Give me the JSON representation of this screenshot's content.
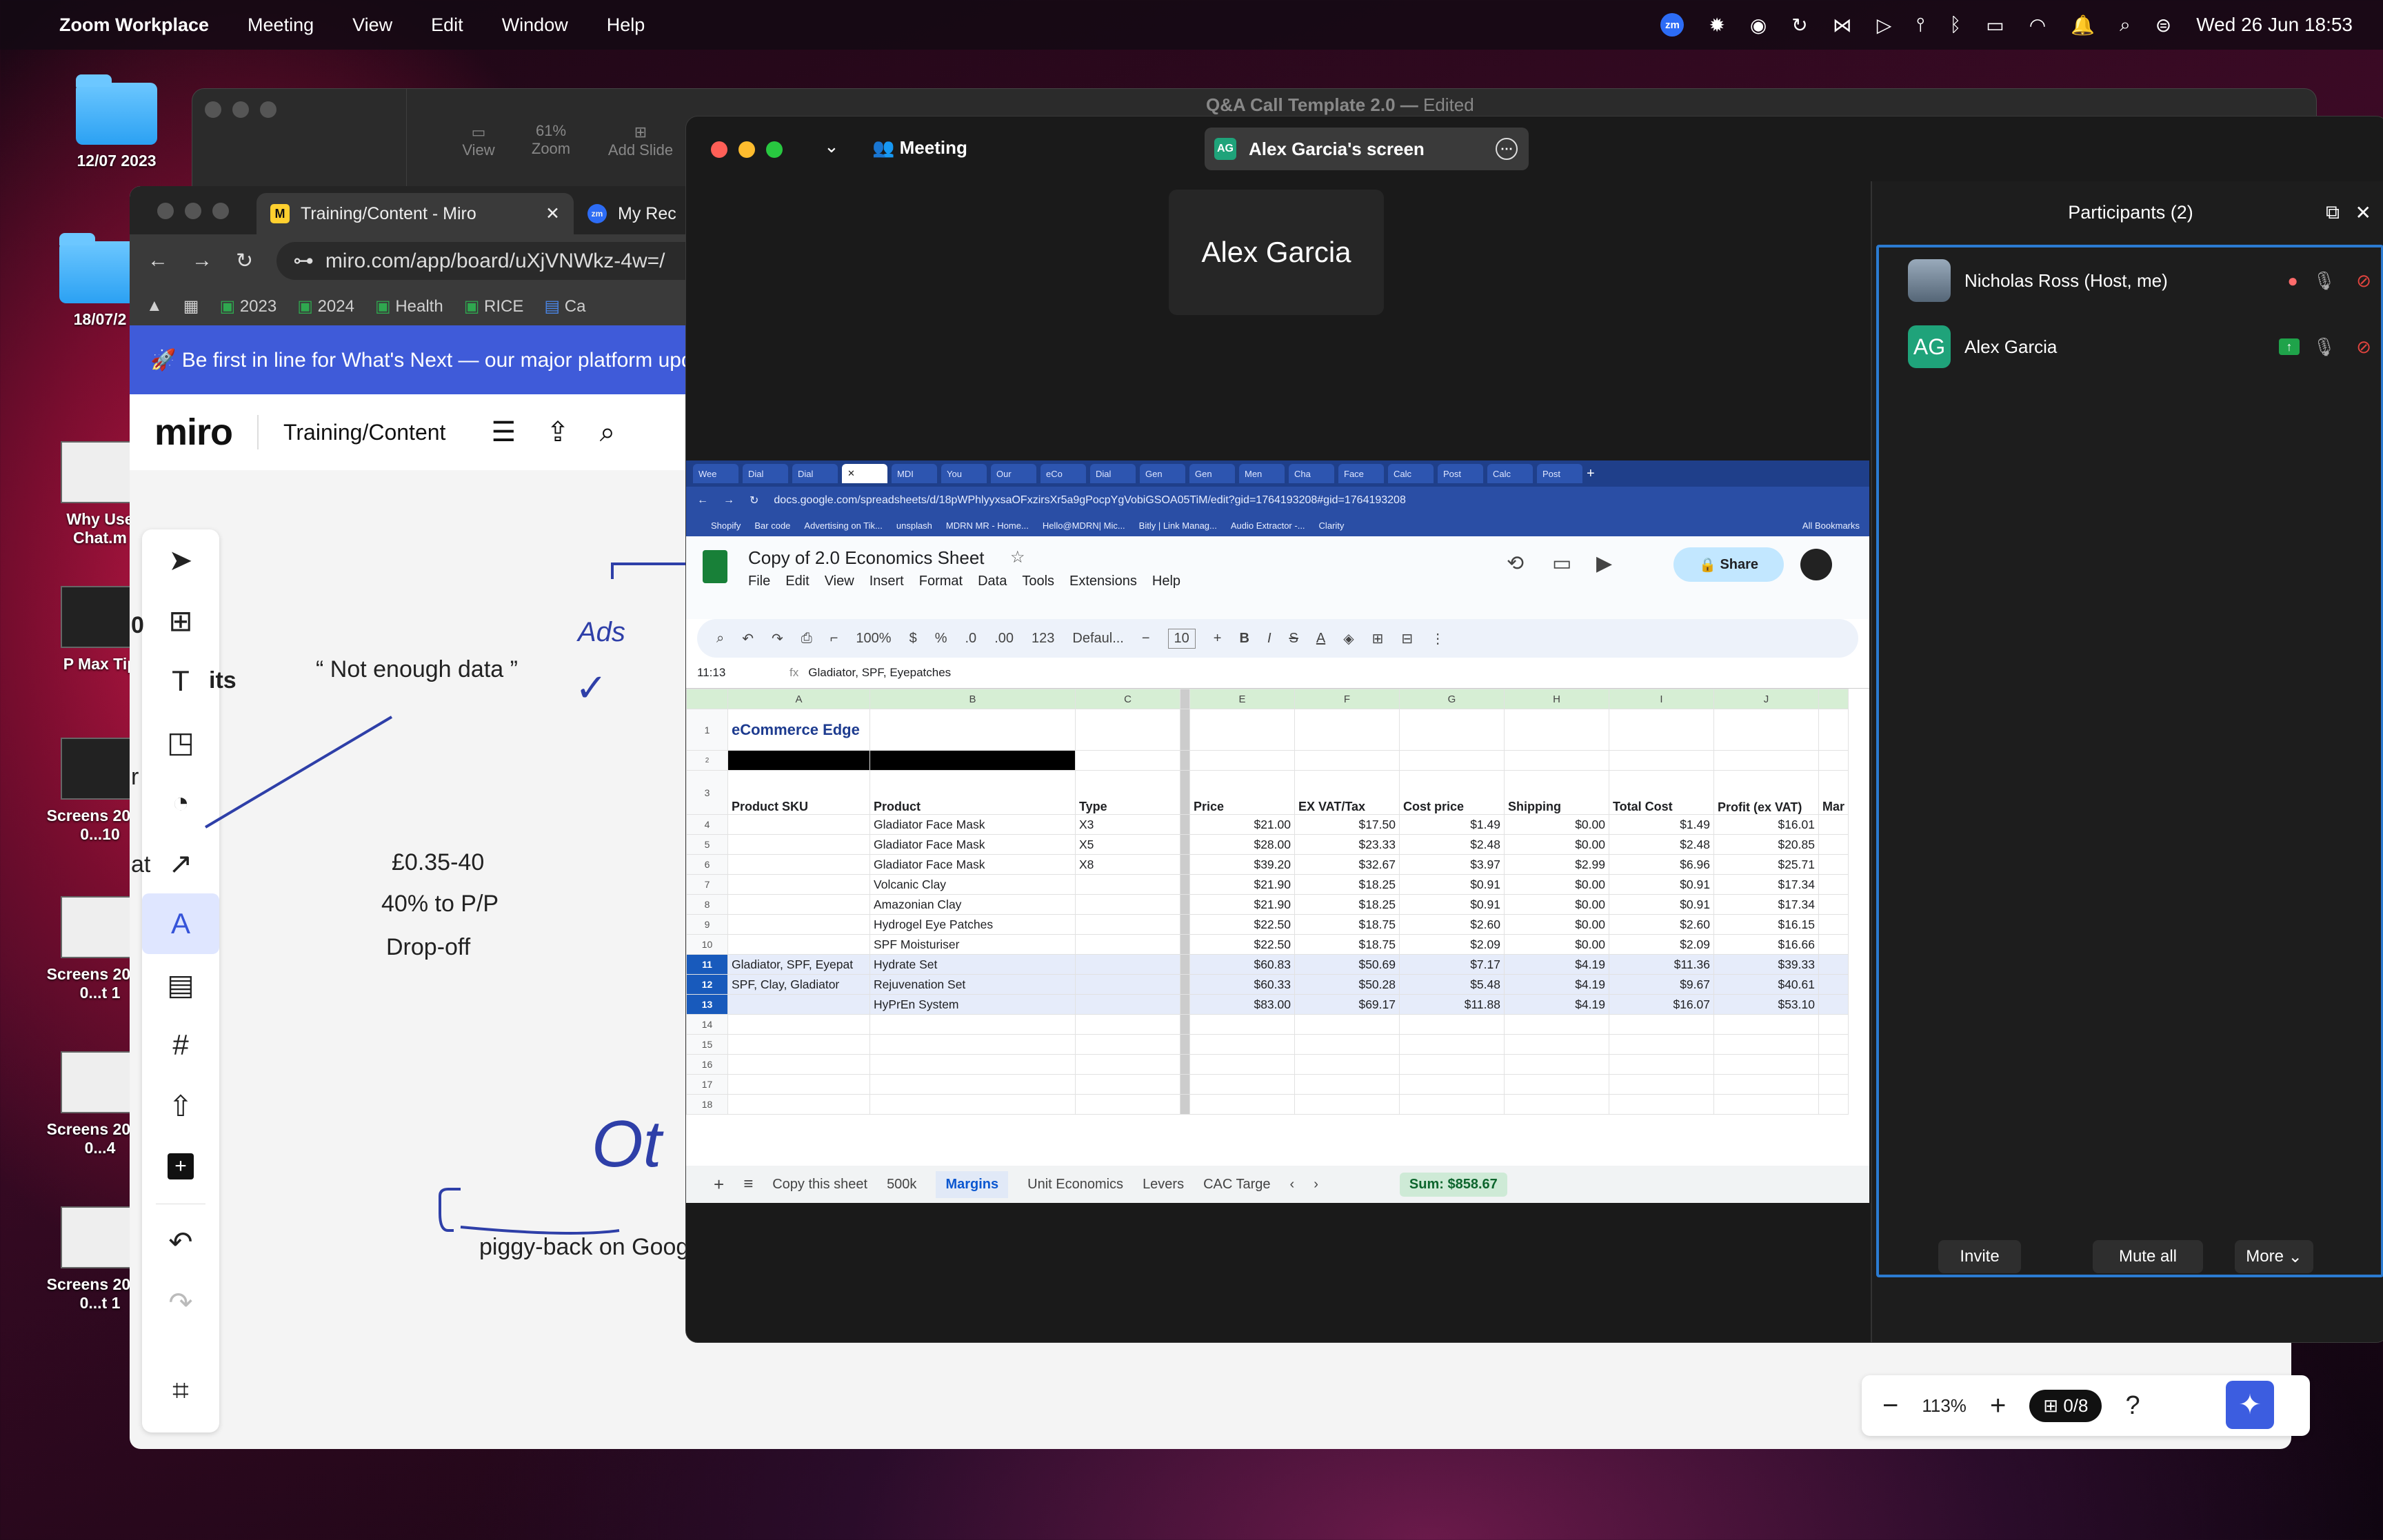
{
  "menubar": {
    "app": "Zoom Workplace",
    "items": [
      "Meeting",
      "View",
      "Edit",
      "Window",
      "Help"
    ],
    "datetime": "Wed 26 Jun  18:53",
    "zm": "zm"
  },
  "desktop": {
    "icons": [
      {
        "label": "12/07 2023"
      },
      {
        "label": "18/07/2"
      },
      {
        "label": "Why Use Chat.m"
      },
      {
        "label": "P Max Tip"
      },
      {
        "label": "Screens 2024-0...10"
      },
      {
        "label": "Screens 2024-0...t 1"
      },
      {
        "label": "Screens 2024-0...4"
      },
      {
        "label": "Screens 2024-0...t 1"
      }
    ]
  },
  "keynote": {
    "title": "Q&A Call Template 2.0",
    "edited": "Edited",
    "toolbar": {
      "view": "View",
      "zoom": "Zoom",
      "zoom_value": "61%",
      "add_slide": "Add Slide"
    }
  },
  "miro_browser": {
    "tabs": [
      "Training/Content - Miro",
      "My Rec"
    ],
    "url": "miro.com/app/board/uXjVNWkz-4w=/",
    "bookmarks": [
      "2023",
      "2024",
      "Health",
      "RICE",
      "Ca"
    ],
    "banner": "🚀 Be first in line for What's Next — our major platform upd",
    "board_name": "Training/Content",
    "logo": "miro",
    "canvas": {
      "quote": "“ Not enough data ”",
      "ads": "Ads",
      "check": "✓",
      "price": "£0.35-40",
      "pct": "40% to P/P",
      "dropoff": "Drop-off",
      "piggy": "piggy-back on Googl",
      "its": "its",
      "zero": "0",
      "r": "r",
      "at": "at",
      "oth": "Ot"
    },
    "zoom_level": "113%",
    "gift_count": "0/8"
  },
  "zoom": {
    "meeting_label": "Meeting",
    "share_label": "Alex Garcia's screen",
    "share_initials": "AG",
    "presenter_name": "Alex Garcia",
    "participants_title": "Participants (2)",
    "participants": [
      {
        "name": "Nicholas Ross (Host, me)",
        "initials": ""
      },
      {
        "name": "Alex Garcia",
        "initials": "AG"
      }
    ],
    "buttons": {
      "invite": "Invite",
      "mute_all": "Mute all",
      "more": "More"
    }
  },
  "sheets": {
    "browser_tabs": [
      "Wee",
      "Dial",
      "Dial",
      "",
      "MDI",
      "You",
      "Our",
      "eCo",
      "Dial",
      "Gen",
      "Gen",
      "Men",
      "Cha",
      "Face",
      "Calc",
      "Post",
      "Calc",
      "Post"
    ],
    "url": "docs.google.com/spreadsheets/d/18pWPhlyyxsaOFxzirsXr5a9gPocpYgVobiGSOA05TiM/edit?gid=1764193208#gid=1764193208",
    "bookmarks": [
      "Shopify",
      "Bar code",
      "Advertising on Tik...",
      "unsplash",
      "MDRN MR - Home...",
      "Hello@MDRN| Mic...",
      "Bitly | Link Manag...",
      "Audio Extractor -...",
      "Clarity",
      "All Bookmarks"
    ],
    "doc_title": "Copy of 2.0 Economics Sheet",
    "menu": [
      "File",
      "Edit",
      "View",
      "Insert",
      "Format",
      "Data",
      "Tools",
      "Extensions",
      "Help"
    ],
    "share": "Share",
    "toolbar": {
      "zoom": "100%",
      "font": "Defaul...",
      "size": "10",
      "currency": "$",
      "percent": "%",
      "dec_less": ".0",
      "dec_more": ".00",
      "fmt": "123",
      "bold": "B",
      "italic": "I",
      "strike": "S",
      "text_color": "A"
    },
    "cell_ref": "11:13",
    "formula": "Gladiator, SPF, Eyepatches",
    "columns": [
      "A",
      "B",
      "C",
      "",
      "E",
      "F",
      "G",
      "H",
      "I",
      "J"
    ],
    "brand": "eCommerce Edge",
    "headers": [
      "Product SKU",
      "Product",
      "Type",
      "",
      "Price",
      "EX VAT/Tax",
      "Cost price",
      "Shipping",
      "Total Cost",
      "Profit (ex VAT)",
      "Mar"
    ],
    "rows": [
      {
        "n": "4",
        "sku": "",
        "product": "Gladiator Face Mask",
        "type": "X3",
        "price": "$21.00",
        "exvat": "$17.50",
        "cost": "$1.49",
        "ship": "$0.00",
        "total": "$1.49",
        "profit": "$16.01"
      },
      {
        "n": "5",
        "sku": "",
        "product": "Gladiator Face Mask",
        "type": "X5",
        "price": "$28.00",
        "exvat": "$23.33",
        "cost": "$2.48",
        "ship": "$0.00",
        "total": "$2.48",
        "profit": "$20.85"
      },
      {
        "n": "6",
        "sku": "",
        "product": "Gladiator Face Mask",
        "type": "X8",
        "price": "$39.20",
        "exvat": "$32.67",
        "cost": "$3.97",
        "ship": "$2.99",
        "total": "$6.96",
        "profit": "$25.71"
      },
      {
        "n": "7",
        "sku": "",
        "product": "Volcanic Clay",
        "type": "",
        "price": "$21.90",
        "exvat": "$18.25",
        "cost": "$0.91",
        "ship": "$0.00",
        "total": "$0.91",
        "profit": "$17.34"
      },
      {
        "n": "8",
        "sku": "",
        "product": "Amazonian Clay",
        "type": "",
        "price": "$21.90",
        "exvat": "$18.25",
        "cost": "$0.91",
        "ship": "$0.00",
        "total": "$0.91",
        "profit": "$17.34"
      },
      {
        "n": "9",
        "sku": "",
        "product": "Hydrogel Eye Patches",
        "type": "",
        "price": "$22.50",
        "exvat": "$18.75",
        "cost": "$2.60",
        "ship": "$0.00",
        "total": "$2.60",
        "profit": "$16.15"
      },
      {
        "n": "10",
        "sku": "",
        "product": "SPF Moisturiser",
        "type": "",
        "price": "$22.50",
        "exvat": "$18.75",
        "cost": "$2.09",
        "ship": "$0.00",
        "total": "$2.09",
        "profit": "$16.66"
      },
      {
        "n": "11",
        "sku": "Gladiator, SPF, Eyepat",
        "product": "Hydrate Set",
        "type": "",
        "price": "$60.83",
        "exvat": "$50.69",
        "cost": "$7.17",
        "ship": "$4.19",
        "total": "$11.36",
        "profit": "$39.33",
        "sel": true
      },
      {
        "n": "12",
        "sku": "SPF, Clay, Gladiator",
        "product": "Rejuvenation Set",
        "type": "",
        "price": "$60.33",
        "exvat": "$50.28",
        "cost": "$5.48",
        "ship": "$4.19",
        "total": "$9.67",
        "profit": "$40.61",
        "sel": true
      },
      {
        "n": "13",
        "sku": "",
        "product": "HyPrEn System",
        "type": "",
        "price": "$83.00",
        "exvat": "$69.17",
        "cost": "$11.88",
        "ship": "$4.19",
        "total": "$16.07",
        "profit": "$53.10",
        "sel": true
      }
    ],
    "empty_rows": [
      "14",
      "15",
      "16",
      "17",
      "18"
    ],
    "sheet_tabs": [
      "Copy this sheet",
      "500k",
      "Margins",
      "Unit Economics",
      "Levers",
      "CAC Targe"
    ],
    "active_sheet": "Margins",
    "sum": "Sum: $858.67"
  }
}
